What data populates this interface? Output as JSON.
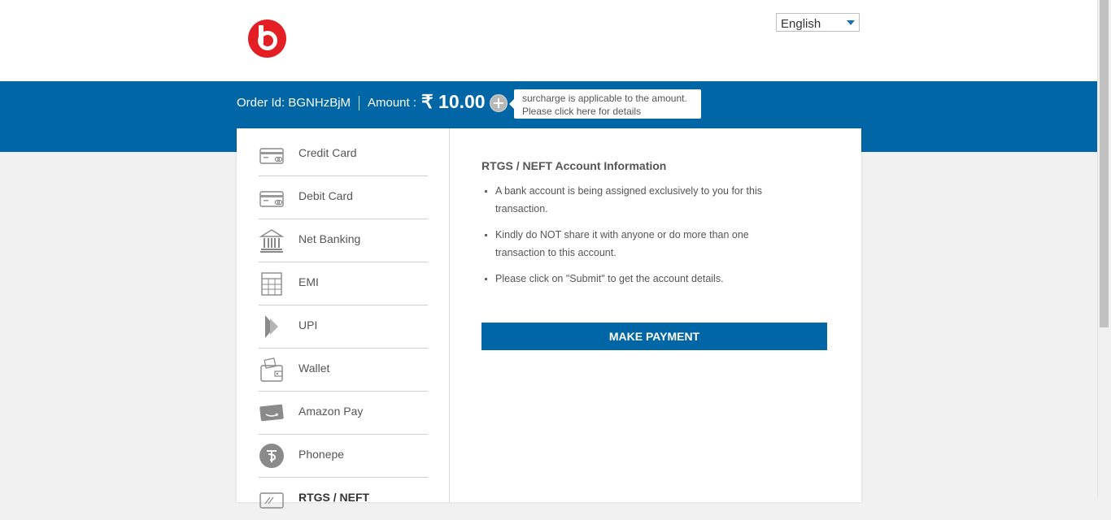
{
  "header": {
    "logo_name": "beats-logo",
    "language": {
      "selected": "English"
    }
  },
  "order_bar": {
    "order_id_text": "Order Id: BGNHzBjM",
    "amount_label": "Amount :",
    "amount_value": "₹ 10.00",
    "surcharge_tooltip": {
      "line1": "surcharge is applicable to the amount.",
      "line2": "Please click here for details"
    }
  },
  "sidebar": {
    "items": [
      {
        "label": "Credit Card",
        "icon": "credit-card-icon"
      },
      {
        "label": "Debit Card",
        "icon": "debit-card-icon"
      },
      {
        "label": "Net Banking",
        "icon": "bank-icon"
      },
      {
        "label": "EMI",
        "icon": "calculator-icon"
      },
      {
        "label": "UPI",
        "icon": "upi-icon"
      },
      {
        "label": "Wallet",
        "icon": "wallet-icon"
      },
      {
        "label": "Amazon Pay",
        "icon": "amazon-pay-icon"
      },
      {
        "label": "Phonepe",
        "icon": "phonepe-icon"
      },
      {
        "label": "RTGS / NEFT",
        "icon": "rtgs-neft-icon",
        "active": true
      }
    ]
  },
  "content": {
    "title": "RTGS / NEFT Account Information",
    "bullets": [
      "A bank account is being assigned exclusively to you for this transaction.",
      "Kindly do NOT share it with anyone or do more than one transaction to this account.",
      "Please click on \"Submit\" to get the account details."
    ],
    "pay_button": "MAKE PAYMENT"
  },
  "colors": {
    "brand_blue": "#0066a6",
    "logo_red": "#e31e25",
    "page_bg": "#f1f1f1"
  }
}
